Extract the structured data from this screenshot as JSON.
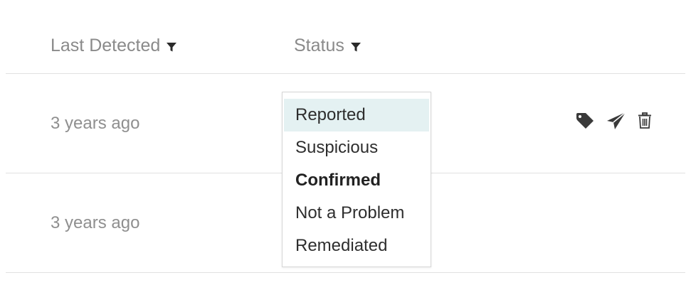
{
  "table": {
    "columns": [
      {
        "label": "Last Detected",
        "filter_icon": "filter-icon"
      },
      {
        "label": "Status",
        "filter_icon": "filter-icon"
      }
    ],
    "rows": [
      {
        "last_detected": "3 years ago",
        "actions": [
          "tag-icon",
          "send-icon",
          "trash-icon"
        ]
      },
      {
        "last_detected": "3 years ago"
      }
    ]
  },
  "status_dropdown": {
    "options": [
      "Reported",
      "Suspicious",
      "Confirmed",
      "Not a Problem",
      "Remediated"
    ],
    "highlighted": "Reported",
    "selected": "Confirmed"
  },
  "colors": {
    "header_text": "#8a8a8a",
    "muted_text": "#8f8f8f",
    "icon": "#3a3a3a",
    "highlight_bg": "#e4f1f2",
    "divider": "#e1e1e1"
  }
}
